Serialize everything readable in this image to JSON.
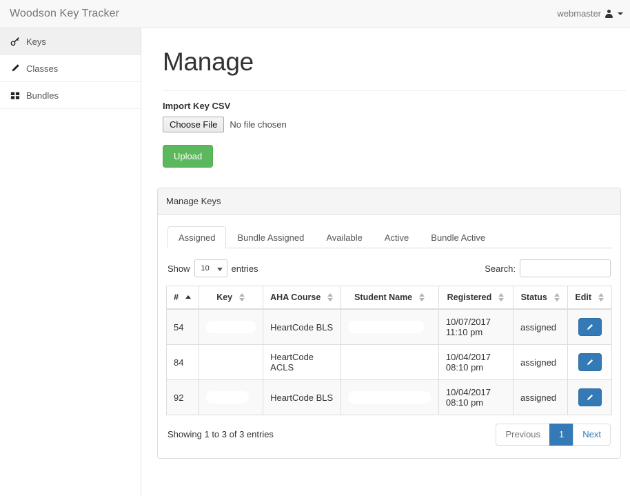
{
  "navbar": {
    "brand": "Woodson Key Tracker",
    "user": "webmaster",
    "user_icon": "user-icon",
    "caret_icon": "caret-down-icon"
  },
  "sidebar": {
    "items": [
      {
        "label": "Keys",
        "icon": "key-icon",
        "active": true
      },
      {
        "label": "Classes",
        "icon": "pencil-icon",
        "active": false
      },
      {
        "label": "Bundles",
        "icon": "th-large-icon",
        "active": false
      }
    ]
  },
  "main": {
    "page_title": "Manage",
    "import_label": "Import Key CSV",
    "choose_file_label": "Choose File",
    "no_file_text": "No file chosen",
    "upload_label": "Upload",
    "upload_color": "#5cb85c"
  },
  "panel": {
    "heading": "Manage Keys",
    "tabs": [
      {
        "label": "Assigned",
        "active": true
      },
      {
        "label": "Bundle Assigned",
        "active": false
      },
      {
        "label": "Available",
        "active": false
      },
      {
        "label": "Active",
        "active": false
      },
      {
        "label": "Bundle Active",
        "active": false
      }
    ],
    "controls": {
      "show_label": "Show",
      "entries_label": "entries",
      "page_size": "10",
      "search_label": "Search:",
      "search_value": "",
      "search_placeholder": ""
    },
    "table": {
      "columns": [
        {
          "label": "#",
          "sort": "asc"
        },
        {
          "label": "Key",
          "sort": "none"
        },
        {
          "label": "AHA Course",
          "sort": "none"
        },
        {
          "label": "Student Name",
          "sort": "none"
        },
        {
          "label": "Registered",
          "sort": "none"
        },
        {
          "label": "Status",
          "sort": "none"
        },
        {
          "label": "Edit",
          "sort": "none"
        }
      ],
      "rows": [
        {
          "num": "54",
          "key": "",
          "key_redacted": true,
          "course": "HeartCode BLS",
          "student": "",
          "student_redacted": true,
          "registered": "10/07/2017 11:10 pm",
          "status": "assigned",
          "edit_icon": "pencil-icon"
        },
        {
          "num": "84",
          "key": "",
          "key_redacted": false,
          "course": "HeartCode ACLS",
          "student": "",
          "student_redacted": false,
          "registered": "10/04/2017 08:10 pm",
          "status": "assigned",
          "edit_icon": "pencil-icon"
        },
        {
          "num": "92",
          "key": "",
          "key_redacted": true,
          "course": "HeartCode BLS",
          "student": "",
          "student_redacted": true,
          "registered": "10/04/2017 08:10 pm",
          "status": "assigned",
          "edit_icon": "pencil-icon"
        }
      ]
    },
    "footer": {
      "info": "Showing 1 to 3 of 3 entries",
      "previous": "Previous",
      "current_page": "1",
      "next": "Next",
      "active_color": "#337ab7"
    }
  }
}
